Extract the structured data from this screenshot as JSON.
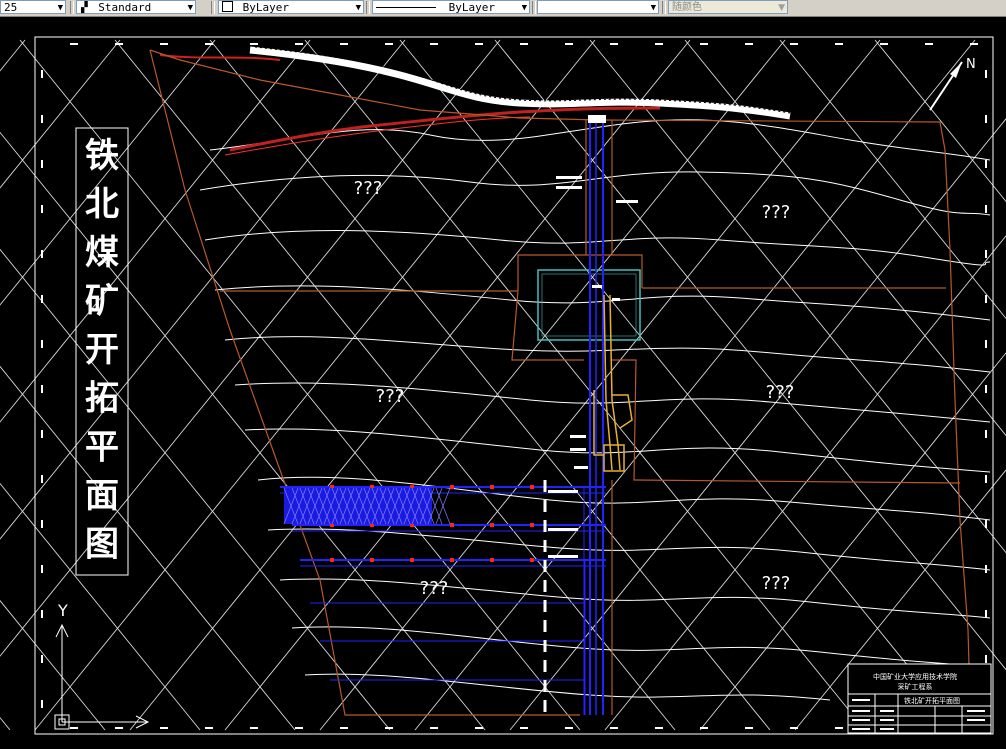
{
  "toolbar": {
    "layer_combo": "25",
    "textstyle_combo": "Standard",
    "color_combo": "ByLayer",
    "linetype_combo": "ByLayer",
    "lineweight_combo": "",
    "plotstyle_combo": "随颜色"
  },
  "drawing": {
    "title_chars": [
      "铁",
      "北",
      "煤",
      "矿",
      "开",
      "拓",
      "平",
      "面",
      "图"
    ],
    "region_labels": [
      "???",
      "???",
      "???",
      "???",
      "???",
      "???"
    ],
    "north_label": "N",
    "ucs_label": "Y",
    "titleblock": {
      "line1": "中国矿业大学应用技术学院",
      "line2": "采矿工程系",
      "line3": "铁北矿开拓平面图"
    }
  },
  "colors": {
    "background": "#000000",
    "contours": "#ffffff",
    "boundary": "#b8582a",
    "shafts": "#2222ff",
    "yellow_shaft": "#e8b030",
    "cyan_box": "#40c0c0",
    "river_red": "#d02020"
  }
}
